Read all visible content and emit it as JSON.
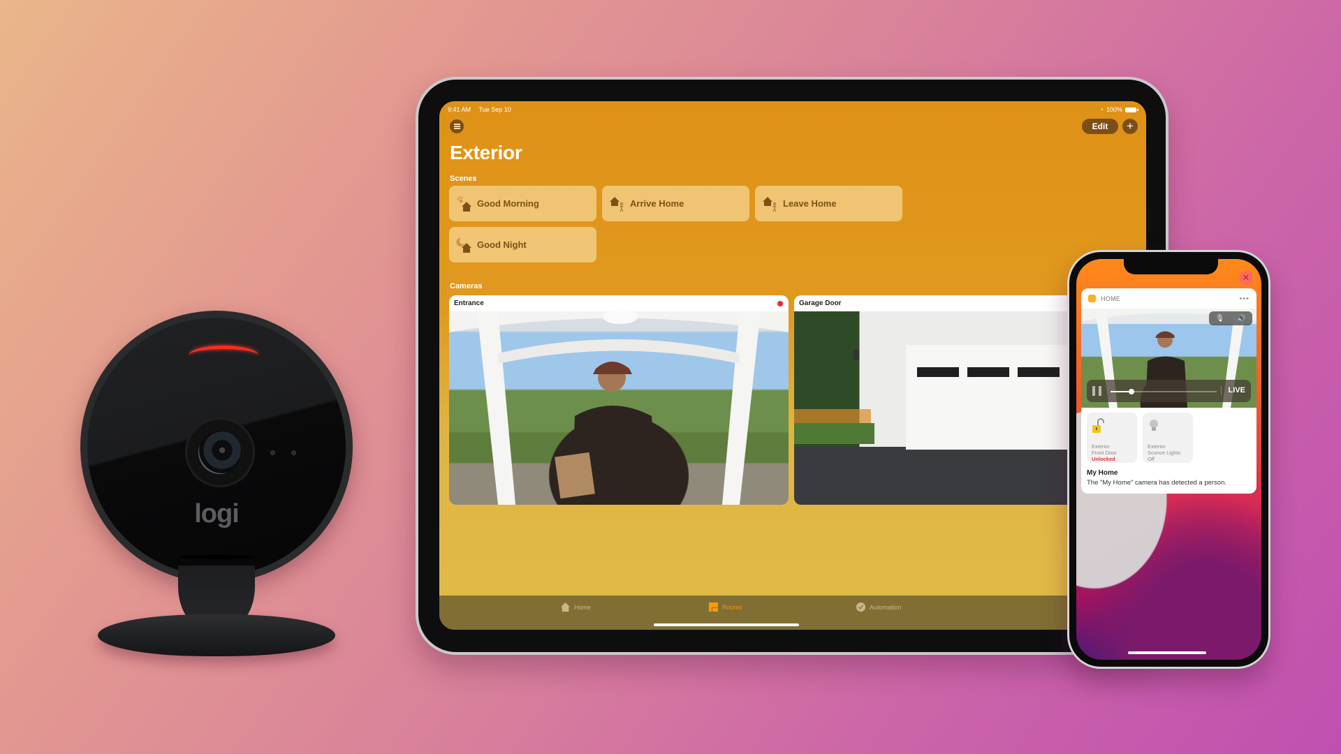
{
  "background": {
    "gradient_colors": [
      "#eab68a",
      "#d9829a",
      "#c050b0"
    ]
  },
  "logi_camera": {
    "brand_logo": "logi",
    "status_led_color": "#ff2a1e"
  },
  "ipad": {
    "status_bar": {
      "time": "9:41 AM",
      "date": "Tue Sep 10",
      "wifi_icon": "wifi-icon",
      "battery": "100%"
    },
    "toolbar": {
      "menu_icon": "list-icon",
      "edit_label": "Edit",
      "add_label": "+"
    },
    "page_title": "Exterior",
    "accent_color": "#df9117",
    "scenes": {
      "label": "Scenes",
      "items": [
        {
          "label": "Good Morning",
          "icon": "sun-house-icon"
        },
        {
          "label": "Arrive Home",
          "icon": "arrive-house-icon"
        },
        {
          "label": "Leave Home",
          "icon": "leave-house-icon"
        },
        {
          "label": "Good Night",
          "icon": "moon-house-icon"
        }
      ]
    },
    "cameras": {
      "label": "Cameras",
      "items": [
        {
          "name": "Entrance",
          "recording": true
        },
        {
          "name": "Garage Door",
          "recording": false
        }
      ]
    },
    "tabs": [
      {
        "label": "Home",
        "icon": "house-icon",
        "active": false
      },
      {
        "label": "Rooms",
        "icon": "rooms-icon",
        "active": true
      },
      {
        "label": "Automation",
        "icon": "clock-check-icon",
        "active": false
      }
    ]
  },
  "iphone": {
    "notification": {
      "app_name": "HOME",
      "more_label": "•••",
      "close_label": "✕",
      "player": {
        "live_label": "LIVE",
        "progress": 0.2
      },
      "audio": {
        "mic_icon": "mic-muted-icon",
        "speaker_icon": "speaker-icon"
      },
      "accessories": [
        {
          "line1": "Exterior",
          "line2": "Front Door",
          "state": "Unlocked",
          "state_color": "#e0323a",
          "icon": "unlocked-padlock-icon"
        },
        {
          "line1": "Exterior",
          "line2": "Sconce Lights",
          "state": "Off",
          "state_color": "#8a8a8c",
          "icon": "lightbulb-icon"
        }
      ],
      "title": "My Home",
      "body": "The \"My Home\" camera has detected a person."
    }
  }
}
